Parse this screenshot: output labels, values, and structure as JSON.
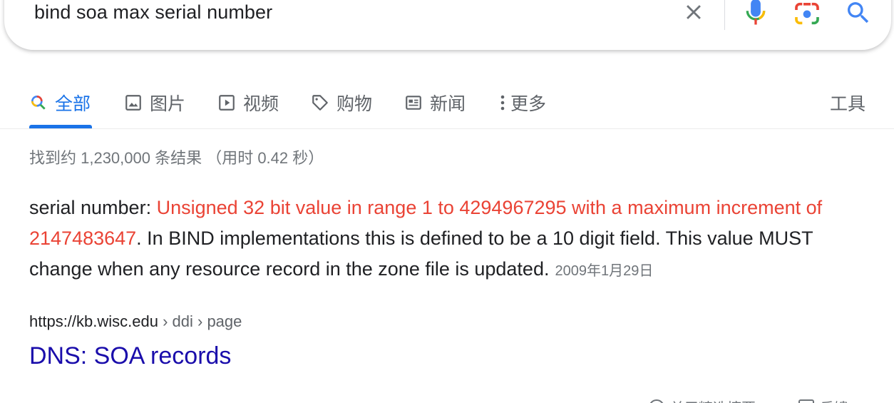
{
  "search": {
    "query": "bind soa max serial number"
  },
  "tabs": [
    {
      "label": "全部",
      "icon": "search-icon"
    },
    {
      "label": "图片",
      "icon": "image-icon"
    },
    {
      "label": "视频",
      "icon": "video-icon"
    },
    {
      "label": "购物",
      "icon": "tag-icon"
    },
    {
      "label": "新闻",
      "icon": "news-icon"
    },
    {
      "label": "更多",
      "icon": "more-vert-icon"
    }
  ],
  "tools_label": "工具",
  "result_stats": "找到约 1,230,000 条结果 （用时 0.42 秒）",
  "featured_snippet": {
    "prefix": "serial number: ",
    "highlight": "Unsigned 32 bit value in range 1 to 4294967295 with a maximum increment of 2147483647",
    "rest": ". In BIND implementations this is defined to be a 10 digit field. This value MUST change when any resource record in the zone file is updated.",
    "date": "2009年1月29日"
  },
  "result": {
    "domain": "https://kb.wisc.edu",
    "path": " › ddi › page",
    "title": "DNS: SOA records"
  },
  "footer": {
    "about_label": "关于精选摘要",
    "feedback_label": "反馈"
  },
  "colors": {
    "active_tab": "#1a73e8",
    "highlight": "#ea4335",
    "link": "#1a0dab"
  }
}
